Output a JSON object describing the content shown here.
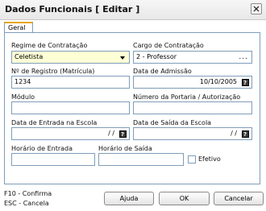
{
  "window": {
    "title": "Dados Funcionais [ Editar ]"
  },
  "tabs": [
    {
      "label": "Geral"
    }
  ],
  "form": {
    "regime": {
      "label": "Regime de Contratação",
      "value": "Celetista"
    },
    "cargo": {
      "label": "Cargo de Contratação",
      "value": "2 - Professor",
      "button": "..."
    },
    "registro": {
      "label": "Nº de Registro (Matrícula)",
      "value": "1234"
    },
    "admissao": {
      "label": "Data de Admissão",
      "value": "10/10/2005"
    },
    "modulo": {
      "label": "Módulo",
      "value": ""
    },
    "portaria": {
      "label": "Número da Portaria / Autorização",
      "value": ""
    },
    "entrada_escola": {
      "label": "Data de Entrada na Escola",
      "value": "/ /"
    },
    "saida_escola": {
      "label": "Data de Saída da Escola",
      "value": "/ /"
    },
    "horario_entrada": {
      "label": "Horário de Entrada",
      "value": ""
    },
    "horario_saida": {
      "label": "Horário de Saída",
      "value": ""
    },
    "efetivo": {
      "label": "Efetivo",
      "checked": false
    }
  },
  "footer": {
    "hint1": "F10 - Confirma",
    "hint2": "ESC - Cancela",
    "help": "Ajuda",
    "ok": "OK",
    "cancel": "Cancelar"
  }
}
